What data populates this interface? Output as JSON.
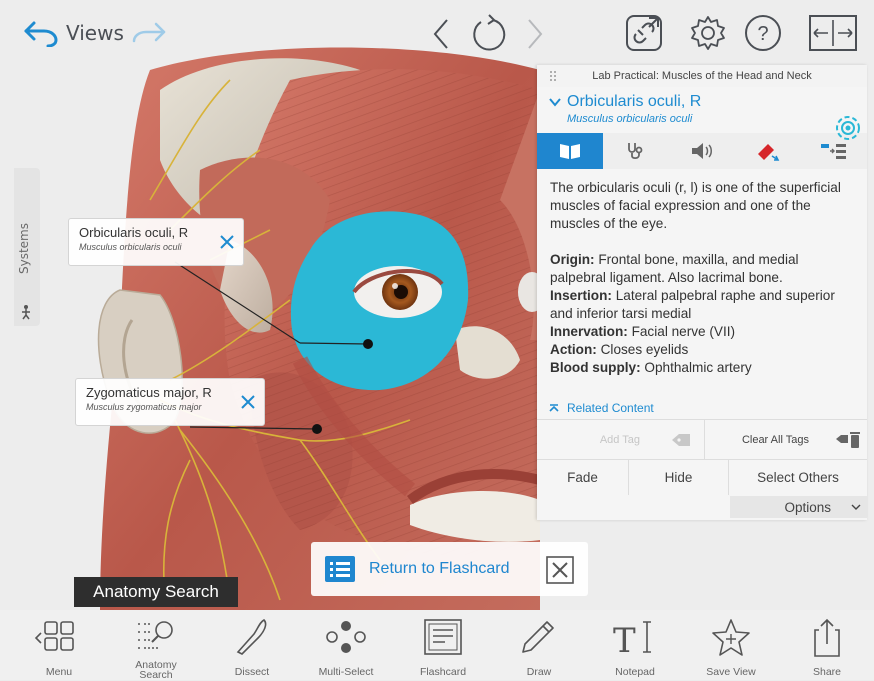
{
  "topbar": {
    "views_label": "Views"
  },
  "systems_tab": {
    "label": "Systems"
  },
  "labels": [
    {
      "name": "Orbicularis oculi, R",
      "latin": "Musculus orbicularis oculi"
    },
    {
      "name": "Zygomaticus major, R",
      "latin": "Musculus zygomaticus major"
    }
  ],
  "panel": {
    "context_title": "Lab Practical: Muscles of the Head and Neck",
    "structure_name": "Orbicularis oculi, R",
    "structure_latin": "Musculus orbicularis oculi",
    "description": "The orbicularis oculi (r, l) is one of the superficial muscles of facial expression and one of the muscles of the eye.",
    "facts": [
      {
        "key": "Origin:",
        "value": " Frontal bone, maxilla, and medial palpebral ligament. Also lacrimal bone."
      },
      {
        "key": "Insertion:",
        "value": " Lateral palpebral raphe and superior and inferior tarsi medial"
      },
      {
        "key": "Innervation:",
        "value": " Facial nerve (VII)"
      },
      {
        "key": "Action:",
        "value": " Closes eyelids"
      },
      {
        "key": "Blood supply:",
        "value": " Ophthalmic artery"
      }
    ],
    "related_content": "Related Content",
    "add_tag": "Add Tag",
    "clear_all_tags": "Clear All Tags",
    "fade": "Fade",
    "hide": "Hide",
    "select_others": "Select Others",
    "options": "Options"
  },
  "flashcard_banner": {
    "text": "Return to Flashcard"
  },
  "tooltip": {
    "text": "Anatomy Search"
  },
  "toolbar": {
    "items": [
      {
        "label": "Menu"
      },
      {
        "label": "Anatomy Search"
      },
      {
        "label": "Dissect"
      },
      {
        "label": "Multi-Select"
      },
      {
        "label": "Flashcard"
      },
      {
        "label": "Draw"
      },
      {
        "label": "Notepad"
      },
      {
        "label": "Save View"
      },
      {
        "label": "Share"
      }
    ]
  },
  "colors": {
    "accent": "#1f86cf",
    "highlight_muscle": "#2bb8d6",
    "muscle": "#c9685a",
    "nerve": "#d8b33a"
  }
}
